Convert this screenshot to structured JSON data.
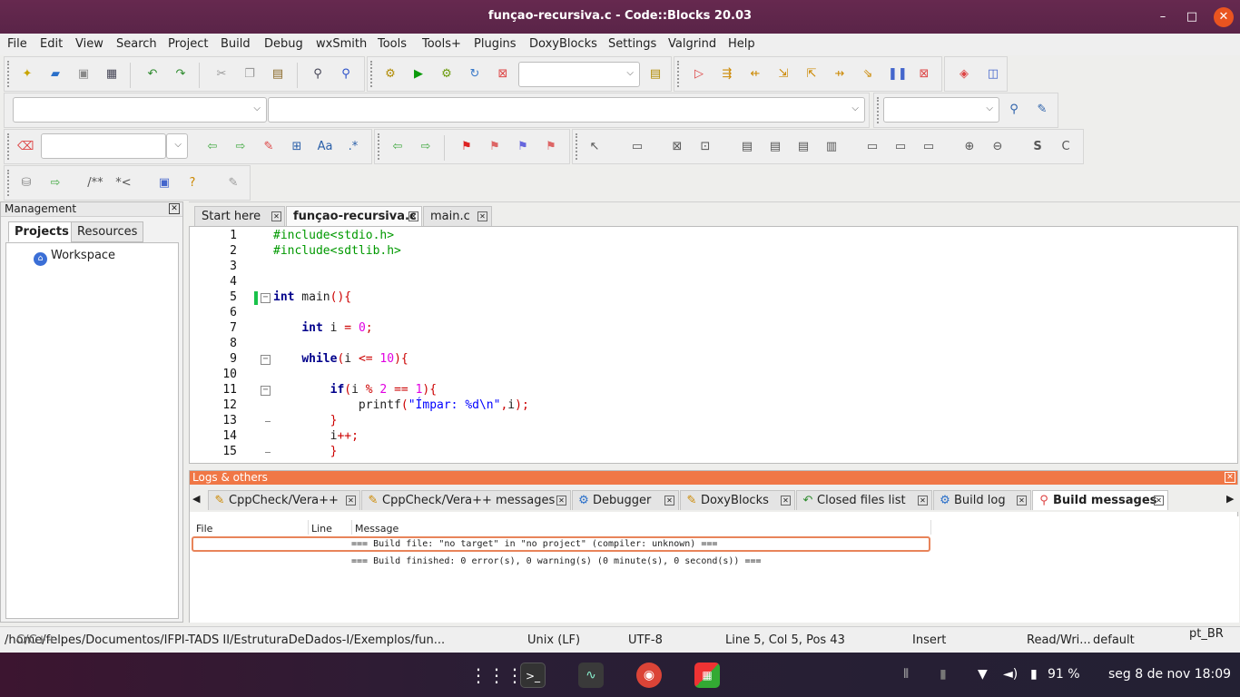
{
  "window": {
    "title": "funçao-recursiva.c - Code::Blocks 20.03",
    "minimize": "–",
    "maximize": "□",
    "close": "✕"
  },
  "menu": [
    "File",
    "Edit",
    "View",
    "Search",
    "Project",
    "Build",
    "Debug",
    "wxSmith",
    "Tools",
    "Tools+",
    "Plugins",
    "DoxyBlocks",
    "Settings",
    "Valgrind",
    "Help"
  ],
  "management": {
    "title": "Management",
    "tabs": [
      "Projects",
      "Resources"
    ],
    "tree_root": "Workspace"
  },
  "editor_tabs": [
    {
      "label": "Start here",
      "active": false
    },
    {
      "label": "funçao-recursiva.c",
      "active": true
    },
    {
      "label": "main.c",
      "active": false
    }
  ],
  "code_lines": [
    "1",
    "2",
    "3",
    "4",
    "5",
    "6",
    "7",
    "8",
    "9",
    "10",
    "11",
    "12",
    "13",
    "14",
    "15"
  ],
  "logs": {
    "title": "Logs & others",
    "tabs": [
      "CppCheck/Vera++",
      "CppCheck/Vera++ messages",
      "Debugger",
      "DoxyBlocks",
      "Closed files list",
      "Build log",
      "Build messages"
    ],
    "columns": [
      "File",
      "Line",
      "Message"
    ],
    "messages": [
      "=== Build file: \"no target\" in \"no project\" (compiler: unknown) ===",
      "=== Build finished: 0 error(s), 0 warning(s) (0 minute(s), 0 second(s)) ==="
    ]
  },
  "status": {
    "path": "/home/felpes/Documentos/IFPI-TADS II/EstruturaDeDados-I/Exemplos/fun...",
    "path_overlay": "C/C++",
    "eol": "Unix (LF)",
    "encoding": "UTF-8",
    "position": "Line 5, Col 5, Pos 43",
    "mode": "Insert",
    "access": "Read/Wri...",
    "profile": "default",
    "lang": "pt_BR"
  },
  "taskbar": {
    "battery": "91 %",
    "datetime": "seg 8 de nov  18:09"
  },
  "colors": {
    "titlebar": "#5e2750",
    "logs_header": "#f07746",
    "close": "#e95420"
  }
}
